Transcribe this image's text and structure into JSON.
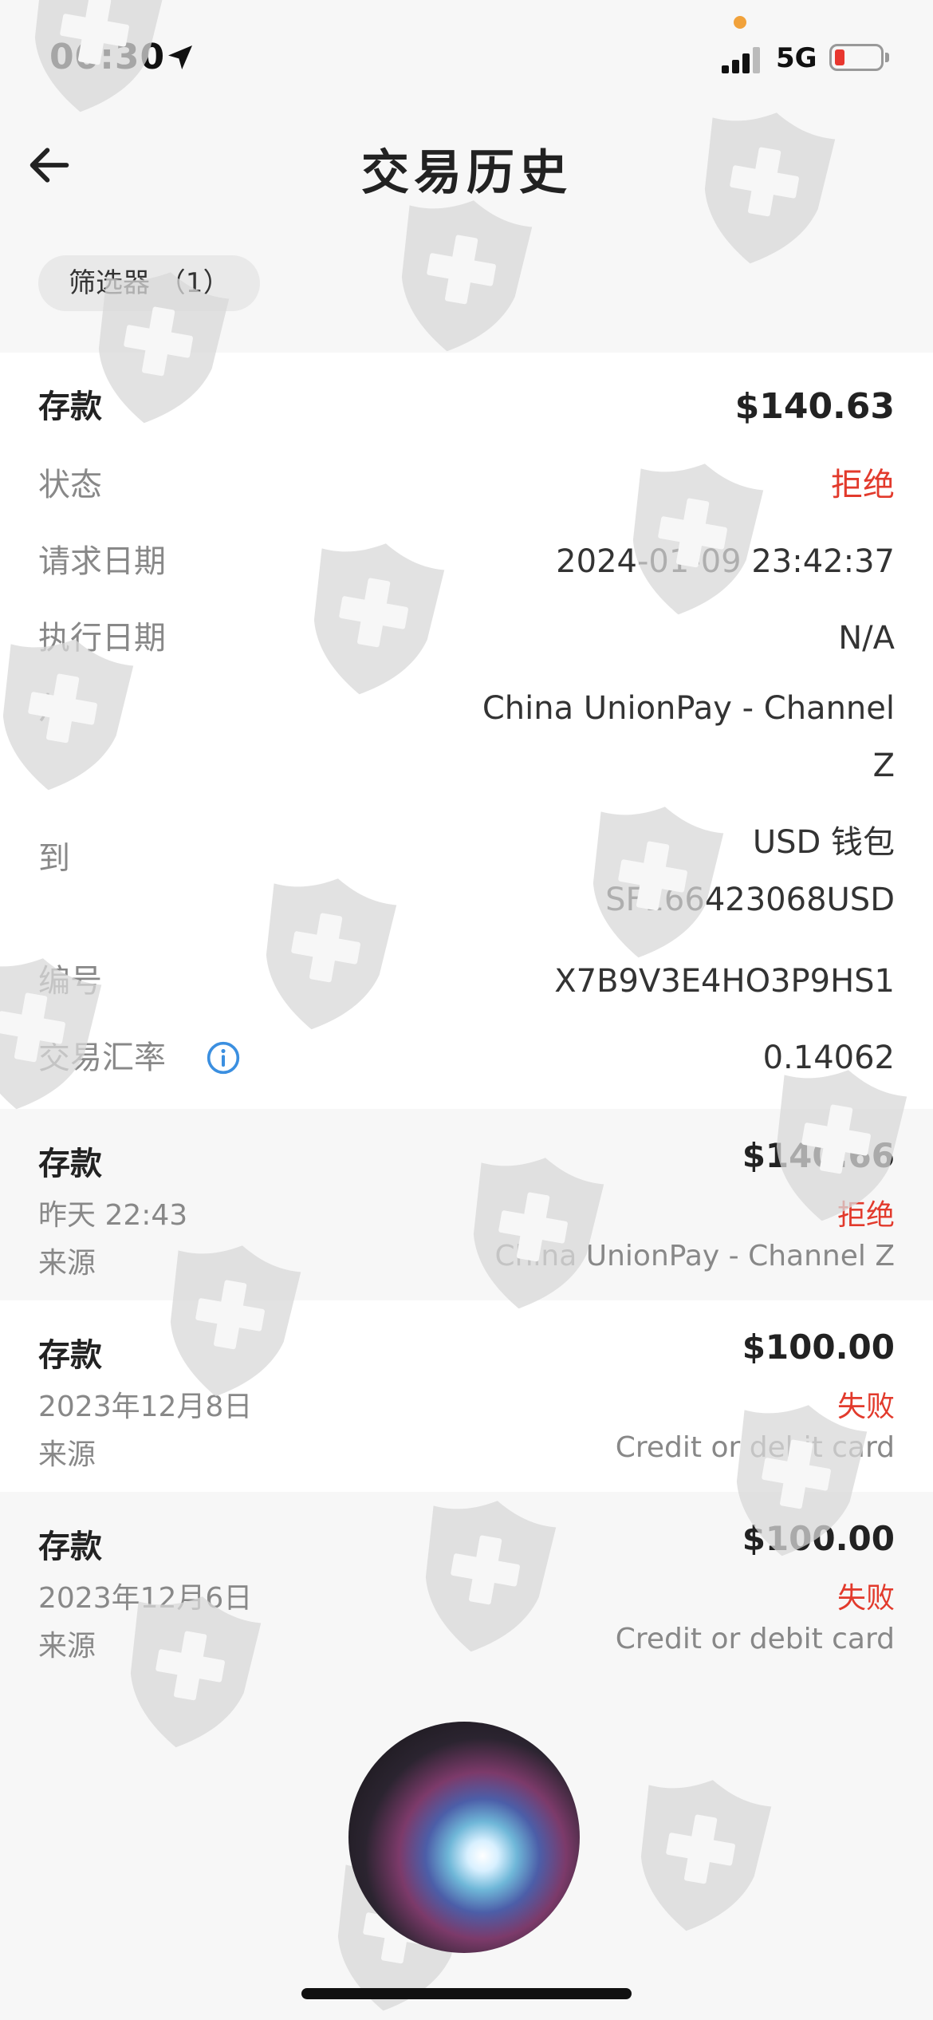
{
  "status_bar": {
    "time": "00:30",
    "network": "5G"
  },
  "header": {
    "title": "交易历史"
  },
  "filter": {
    "label": "筛选器 （1）"
  },
  "detail": {
    "type": "存款",
    "amount": "$140.63",
    "rows": [
      {
        "label": "状态",
        "value": "拒绝"
      },
      {
        "label": "请求日期",
        "value": "2024-01-09 23:42:37"
      },
      {
        "label": "执行日期",
        "value": "N/A"
      },
      {
        "label": "从",
        "value_line1": "China UnionPay - Channel",
        "value_line2": "Z"
      },
      {
        "label": "到",
        "value_line1": "USD 钱包",
        "value_line2": "SF166423068USD"
      },
      {
        "label": "编号",
        "value": "X7B9V3E4HO3P9HS1"
      },
      {
        "label": "交易汇率",
        "value": "0.14062"
      }
    ]
  },
  "transactions": [
    {
      "type": "存款",
      "amount": "$140.66",
      "date": "昨天 22:43",
      "status": "拒绝",
      "source_label": "来源",
      "source": "China UnionPay - Channel Z"
    },
    {
      "type": "存款",
      "amount": "$100.00",
      "date": "2023年12月8日",
      "status": "失败",
      "source_label": "来源",
      "source": "Credit or debit card"
    },
    {
      "type": "存款",
      "amount": "$100.00",
      "date": "2023年12月6日",
      "status": "失败",
      "source_label": "来源",
      "source": "Credit or debit card"
    }
  ],
  "colors": {
    "reject": "#e23a2c",
    "info": "#3b8fe0",
    "accent_dot": "#f1a23b"
  }
}
